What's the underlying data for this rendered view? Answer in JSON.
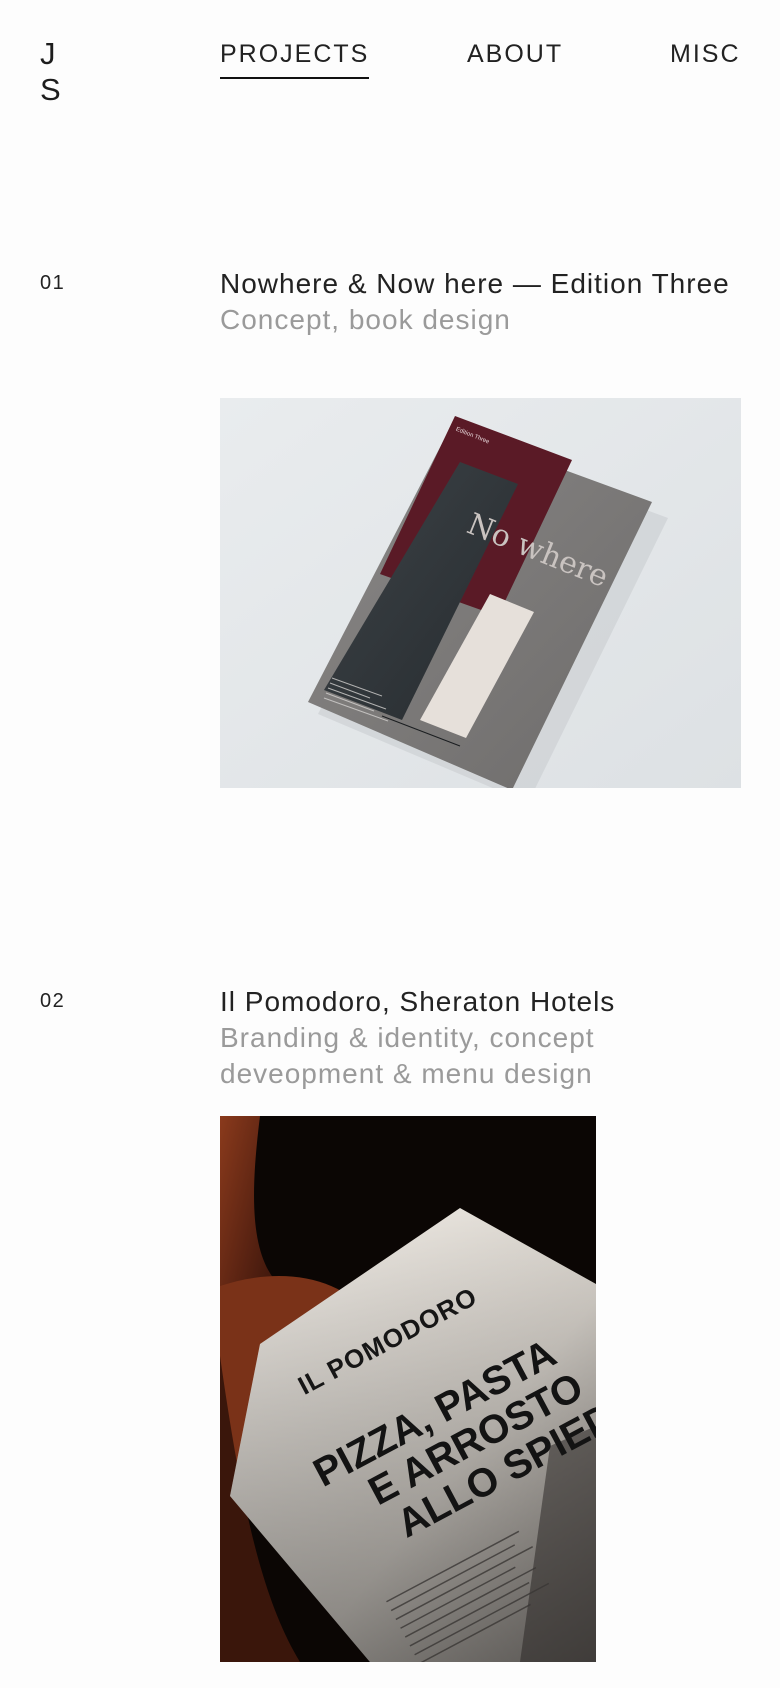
{
  "logo": {
    "line1": "J",
    "line2": "S"
  },
  "nav": {
    "items": [
      {
        "label": "PROJECTS",
        "active": true
      },
      {
        "label": "ABOUT",
        "active": false
      },
      {
        "label": "MISC",
        "active": false
      }
    ]
  },
  "projects": [
    {
      "number": "01",
      "title": "Nowhere & Now here — Edition Three",
      "subtitle": "Concept, book design",
      "image": {
        "cover_text": "No where",
        "small_label": "Edition Three"
      }
    },
    {
      "number": "02",
      "title": "Il Pomodoro, Sheraton Hotels",
      "subtitle": "Branding & identity, concept deveopment & menu design",
      "image": {
        "brand": "IL POMODORO",
        "headline_1": "PIZZA, PASTA",
        "headline_2": "E ARROSTO",
        "headline_3": "ALLO SPIEDO"
      }
    }
  ],
  "colors": {
    "text": "#222222",
    "muted": "#9a9a9a",
    "background": "#fdfdfd"
  }
}
